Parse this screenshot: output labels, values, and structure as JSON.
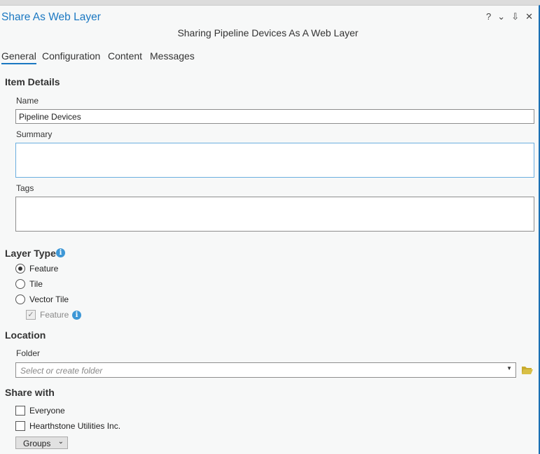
{
  "window": {
    "title": "Share As Web Layer",
    "subtitle": "Sharing Pipeline Devices As A Web Layer",
    "controls": {
      "help": "?",
      "menu": "⌄",
      "pin": "⇩",
      "close": "✕"
    }
  },
  "tabs": [
    {
      "label": "General"
    },
    {
      "label": "Configuration"
    },
    {
      "label": "Content"
    },
    {
      "label": "Messages"
    }
  ],
  "item_details": {
    "heading": "Item Details",
    "name_label": "Name",
    "name_value": "Pipeline Devices",
    "summary_label": "Summary",
    "tags_label": "Tags"
  },
  "layer_type": {
    "heading": "Layer Type",
    "options": [
      "Feature",
      "Tile",
      "Vector Tile"
    ],
    "selected": "Feature",
    "sub_feature": "Feature"
  },
  "location": {
    "heading": "Location",
    "folder_label": "Folder",
    "folder_placeholder": "Select or create folder"
  },
  "share_with": {
    "heading": "Share with",
    "options": [
      "Everyone",
      "Hearthstone Utilities Inc."
    ],
    "groups_label": "Groups"
  },
  "colors": {
    "accent": "#1b78c2",
    "folder": "#d8bf45"
  }
}
